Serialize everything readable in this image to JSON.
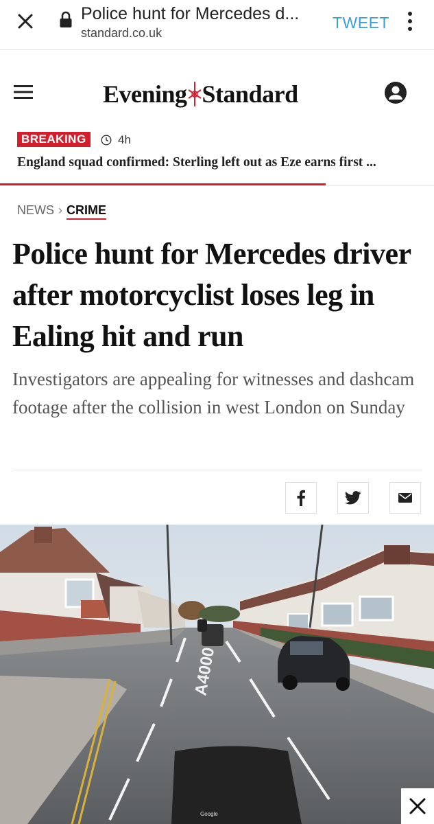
{
  "browser": {
    "page_title": "Police hunt for Mercedes d...",
    "domain": "standard.co.uk",
    "tweet_label": "TWEET"
  },
  "site": {
    "logo_word_1": "Evening",
    "logo_word_2": "Standard"
  },
  "breaking": {
    "badge": "BREAKING",
    "time": "4h",
    "headline": "England squad confirmed: Sterling left out as Eze earns first ...",
    "progress": 0.75
  },
  "breadcrumb": {
    "section": "NEWS",
    "subsection": "CRIME"
  },
  "article": {
    "title": "Police hunt for Mercedes driver after motorcyclist loses leg in Ealing hit and run",
    "standfirst": "Investigators are appealing for witnesses and dashcam footage after the collision in west London on Sunday"
  },
  "photo": {
    "road_marking": "A4000",
    "watermark": "Google"
  },
  "colors": {
    "brand_red": "#d31f2d",
    "tweet_blue": "#3a9fd8"
  },
  "icons": {
    "close": "close-icon",
    "lock": "lock-icon",
    "kebab": "kebab-menu-icon",
    "menu": "hamburger-menu-icon",
    "account": "account-icon",
    "clock": "clock-icon",
    "facebook": "facebook-icon",
    "twitter": "twitter-icon",
    "email": "email-icon"
  }
}
